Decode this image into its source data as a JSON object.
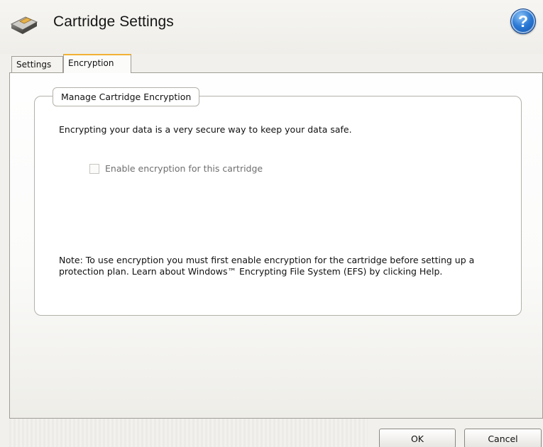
{
  "window": {
    "title": "Cartridge Settings"
  },
  "header": {
    "app_icon": "cartridge-icon",
    "help_icon": "help-icon",
    "help_label": "?"
  },
  "tabs": [
    {
      "label": "Settings",
      "selected": false
    },
    {
      "label": "Encryption",
      "selected": true
    }
  ],
  "encryption": {
    "group_title": "Manage Cartridge Encryption",
    "description": "Encrypting your data is a very secure way to keep your data safe.",
    "checkbox_label": "Enable encryption for this cartridge",
    "checkbox_checked": false,
    "checkbox_enabled": false,
    "note": "Note: To use encryption you must first enable encryption for the cartridge before setting up a protection plan. Learn about Windows™ Encrypting File System (EFS) by clicking Help."
  },
  "buttons": {
    "ok": "OK",
    "cancel": "Cancel"
  },
  "colors": {
    "tab_accent": "#f2b134",
    "help_blue": "#2b7ad6",
    "disabled_text": "#6f6f6f"
  }
}
